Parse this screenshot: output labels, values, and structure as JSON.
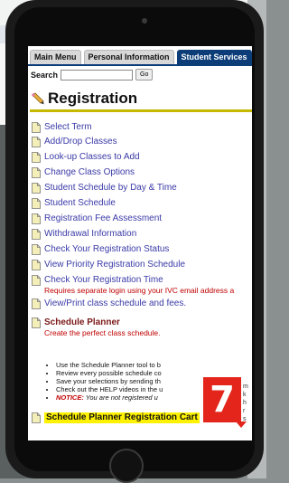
{
  "tabs": [
    {
      "label": "Main Menu"
    },
    {
      "label": "Personal Information"
    },
    {
      "label": "Student Services"
    }
  ],
  "search": {
    "label": "Search",
    "value": "",
    "go_label": "Go"
  },
  "page": {
    "title": "Registration"
  },
  "menu_items": [
    {
      "label": "Select Term"
    },
    {
      "label": "Add/Drop Classes"
    },
    {
      "label": "Look-up Classes to Add"
    },
    {
      "label": "Change Class Options"
    },
    {
      "label": "Student Schedule by Day & Time"
    },
    {
      "label": "Student Schedule"
    },
    {
      "label": "Registration Fee Assessment"
    },
    {
      "label": "Withdrawal Information"
    },
    {
      "label": "Check Your Registration Status"
    },
    {
      "label": "View Priority Registration Schedule"
    },
    {
      "label": "Check Your Registration Time",
      "note": "Requires separate login using your IVC email address a"
    },
    {
      "label": "View/Print class schedule and fees."
    }
  ],
  "schedule_planner": {
    "title": "Schedule Planner",
    "subtitle": "Create the perfect class schedule.",
    "bullets": [
      "Use the Schedule Planner tool to b",
      "Review every possible schedule co",
      "Save your selections by sending th",
      "Check out the HELP videos in the u"
    ],
    "notice_lead": "NOTICE:",
    "notice_text": " You are not registered u"
  },
  "cart": {
    "label": "Schedule Planner Registration Cart"
  },
  "callout": {
    "number": "7",
    "peek": [
      "m",
      "k",
      "h",
      "r",
      "s"
    ]
  },
  "colors": {
    "tab_active": "#0c3d78",
    "link": "#3a3aa8",
    "alert": "#c00000",
    "highlight": "#fff200",
    "callout": "#e3251b",
    "rule": "#c4b800"
  }
}
